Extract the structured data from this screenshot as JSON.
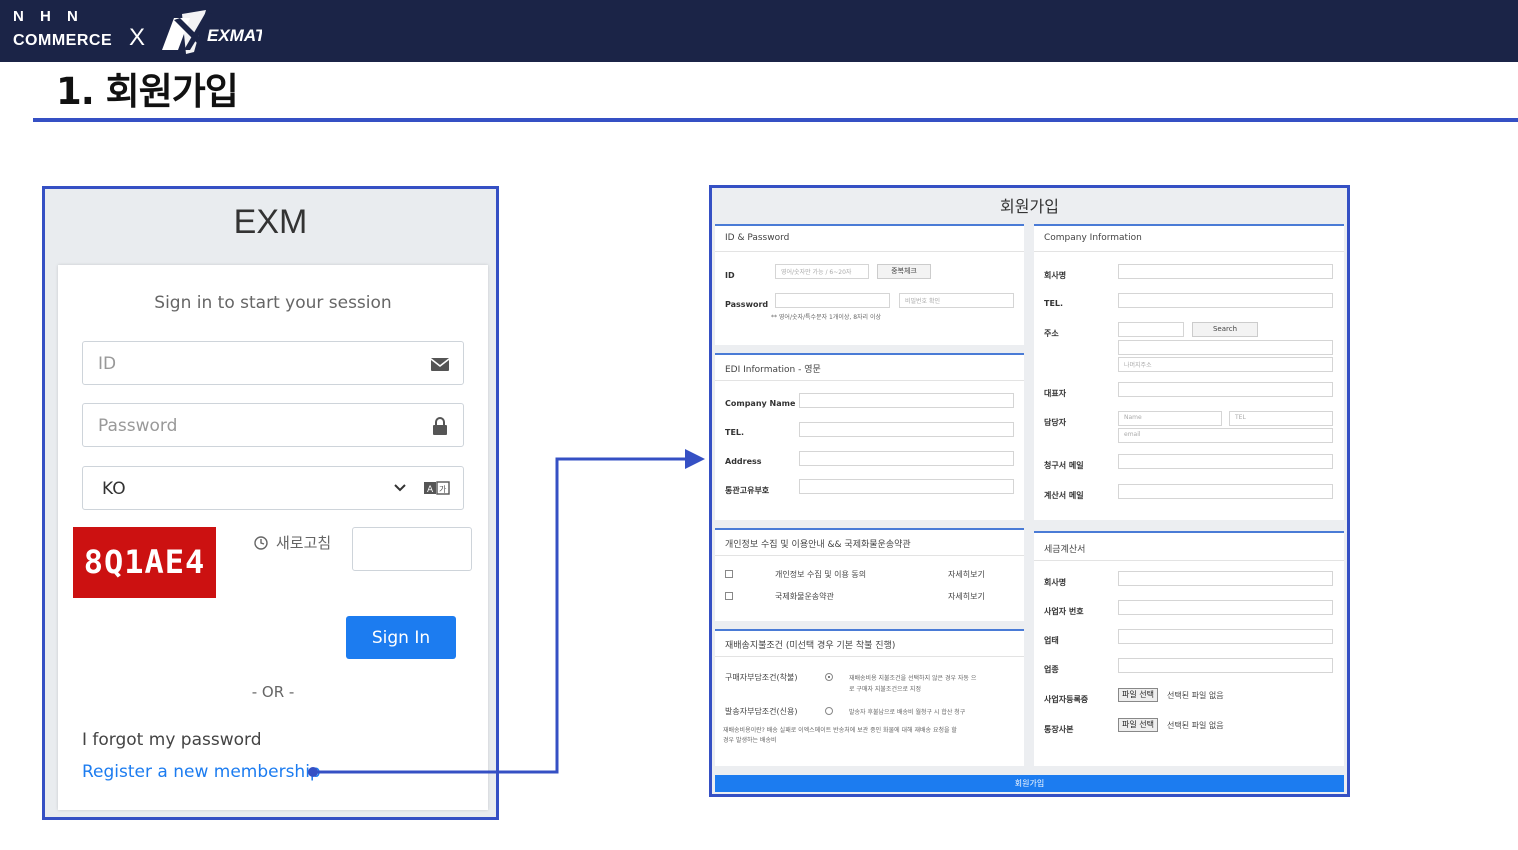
{
  "header": {
    "nhn_line1": "N H N",
    "nhn_line2": "COMMERCE",
    "separator": "X",
    "partner_logo_text": "EXMATE",
    "brand_color": "#1b2447"
  },
  "page": {
    "title": "1. 회원가입",
    "accent_color": "#3550c4"
  },
  "login": {
    "app_title": "EXM",
    "subtitle": "Sign in to start your session",
    "id_placeholder": "ID",
    "password_placeholder": "Password",
    "language_value": "KO",
    "captcha_text": "8Q1AE4",
    "refresh_label": "새로고침",
    "signin_label": "Sign In",
    "or_text": "- OR -",
    "forgot_link": "I forgot my password",
    "register_link": "Register a new membership",
    "icons": {
      "id": "envelope-icon",
      "password": "lock-icon",
      "language": "chevron-down-icon",
      "translate": "translate-icon",
      "refresh": "clock-icon"
    }
  },
  "signup": {
    "title": "회원가입",
    "id_password": {
      "header": "ID & Password",
      "id_label": "ID",
      "id_placeholder": "영어/숫자만 가능 / 6~20자",
      "dup_check": "중복체크",
      "password_label": "Password",
      "password_confirm_placeholder": "비밀번호 확인",
      "password_hint": "** 영어/숫자/특수문자 1개이상, 8자리 이상"
    },
    "edi": {
      "header": "EDI Information - 영문",
      "company_name_label": "Company Name",
      "tel_label": "TEL.",
      "address_label": "Address",
      "customs_label": "통관고유부호"
    },
    "privacy": {
      "header": "개인정보 수집 및 이용안내 && 국제화물운송약관",
      "item1": "개인정보 수집 및 이용 동의",
      "item2": "국제화물운송약관",
      "detail": "자세히보기"
    },
    "redelivery": {
      "header": "재배송지불조건 (미선택 경우 기본 착불 진행)",
      "option1_label": "구매자부담조건(착불)",
      "option1_desc_line1": "재배송비용 지불조건을 선택하지 않은 경우 자동 으",
      "option1_desc_line2": "로 구매자 지불조건으로 지정",
      "option2_label": "발송자부담조건(신용)",
      "option2_desc": "발송자 후불납으로 배송비 월청구 시 합산 청구",
      "note_line1": "재배송비용이란? 배송 실패로 이엑스메이트 반송처에 보관 중인 화물에 대해 재배송 요청을 할",
      "note_line2": "경우 발생하는 배송비"
    },
    "company": {
      "header": "Company Information",
      "company_name_label": "회사명",
      "tel_label": "TEL.",
      "address_label": "주소",
      "search_button": "Search",
      "address_detail_placeholder": "나머지주소",
      "ceo_label": "대표자",
      "manager_label": "담당자",
      "manager_name_placeholder": "Name",
      "manager_tel_placeholder": "TEL",
      "manager_email_placeholder": "email",
      "billing_email_label": "청구서 메일",
      "invoice_email_label": "계산서 메일"
    },
    "tax": {
      "header": "세금계산서",
      "company_name_label": "회사명",
      "biz_number_label": "사업자 번호",
      "biz_type_label": "업태",
      "biz_item_label": "업종",
      "biz_license_label": "사업자등록증",
      "bankbook_label": "통장사본",
      "file_button": "파일 선택",
      "no_file": "선택된 파일 없음"
    },
    "submit_label": "회원가입"
  }
}
